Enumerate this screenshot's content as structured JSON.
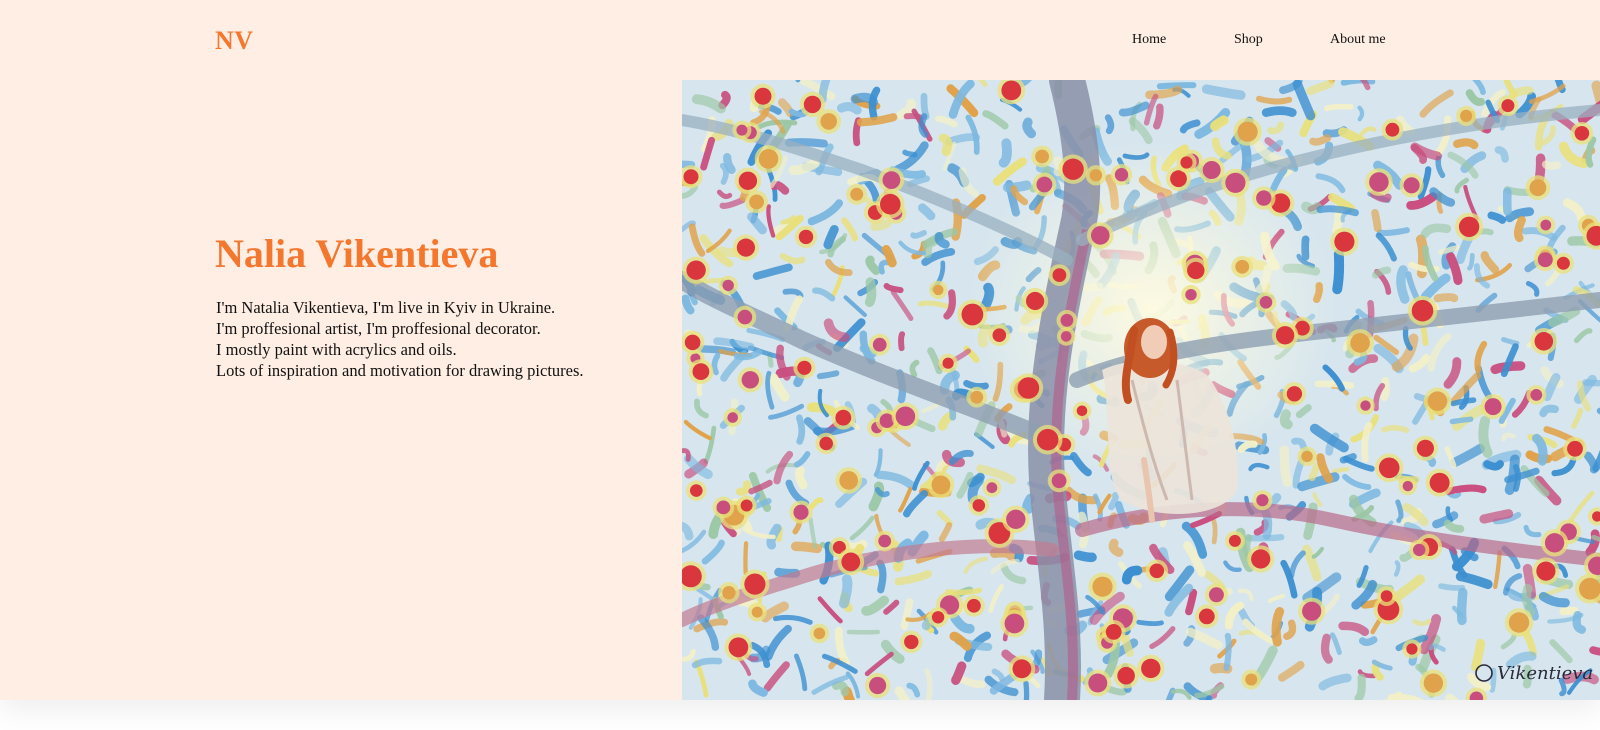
{
  "header": {
    "logo": "NV",
    "nav": [
      {
        "label": "Home"
      },
      {
        "label": "Shop"
      },
      {
        "label": "About me"
      }
    ]
  },
  "hero": {
    "title": "Nalia Vikentieva",
    "lines": [
      "I'm Natalia Vikentieva, I'm live in Kyiv in Ukraine.",
      "I'm proffesional artist, I'm proffesional decorator.",
      "I mostly paint with acrylics and oils.",
      "Lots of inspiration and motivation for drawing pictures."
    ]
  },
  "painting": {
    "signature": "Vikentieva",
    "palette": [
      "#3c8fd0",
      "#7db8e0",
      "#9cc7a6",
      "#e9e07a",
      "#c84e7e",
      "#d9363e",
      "#e0a24a",
      "#f3f0c8"
    ]
  },
  "colors": {
    "accent": "#f4772e",
    "background": "#ffeee4",
    "text": "#111111"
  }
}
